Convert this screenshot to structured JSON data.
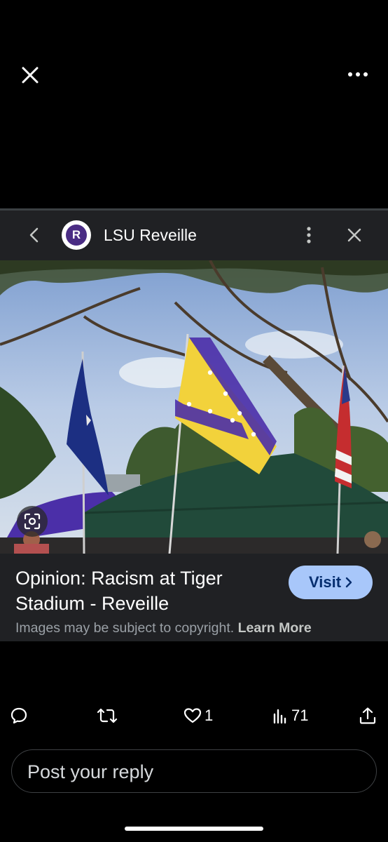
{
  "card": {
    "site_name": "LSU Reveille",
    "logo_letter": "R",
    "caption_title": "Opinion: Racism at Tiger Stadium - Reveille",
    "visit_label": "Visit",
    "copyright_text": "Images may be subject to copyright.",
    "learn_more": "Learn More"
  },
  "actions": {
    "likes": "1",
    "views": "71"
  },
  "reply": {
    "placeholder": "Post your reply"
  },
  "colors": {
    "background": "#000000",
    "card": "#202124",
    "visit_button": "#a8c7fa",
    "logo": "#4a2c84"
  }
}
